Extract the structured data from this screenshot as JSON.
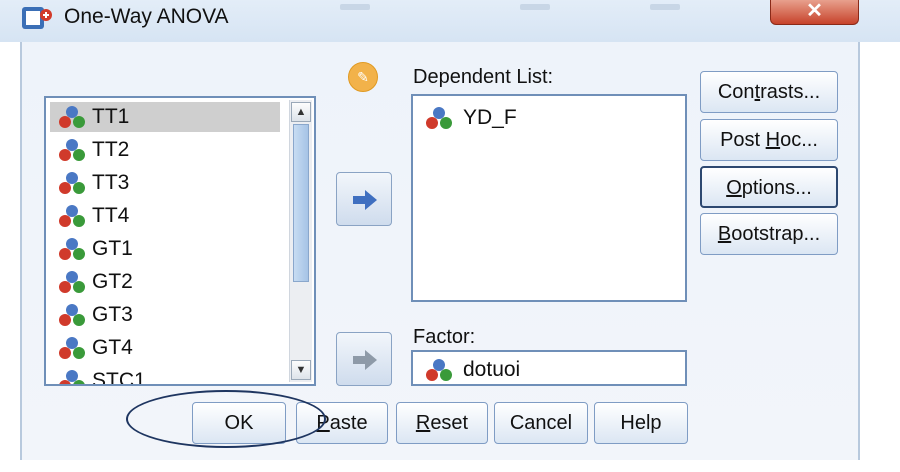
{
  "window": {
    "title": "One-Way ANOVA",
    "close_label": "✕"
  },
  "variables": {
    "items": [
      "TT1",
      "TT2",
      "TT3",
      "TT4",
      "GT1",
      "GT2",
      "GT3",
      "GT4",
      "STC1"
    ],
    "selected_index": 0
  },
  "dependent_list": {
    "label": "Dependent List:",
    "items": [
      "YD_F"
    ]
  },
  "factor": {
    "label": "Factor:",
    "value": "dotuoi"
  },
  "side_buttons": {
    "contrasts": "Contrasts...",
    "post_hoc": "Post Hoc...",
    "options": "Options...",
    "bootstrap": "Bootstrap..."
  },
  "bottom_buttons": {
    "ok": "OK",
    "paste": "Paste",
    "reset": "Reset",
    "cancel": "Cancel",
    "help": "Help"
  },
  "colors": {
    "accent": "#6f8fb8",
    "close": "#c7432b",
    "annotation": "#1e3560"
  }
}
